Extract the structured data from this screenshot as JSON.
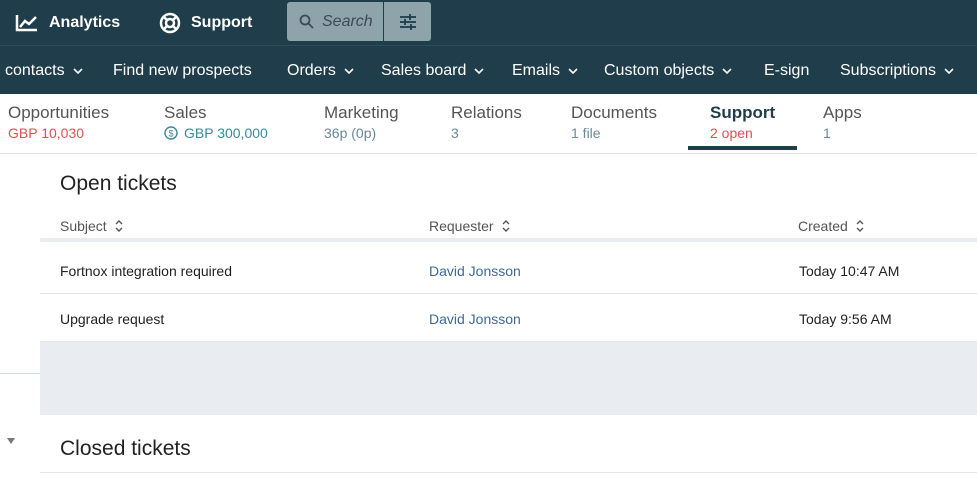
{
  "topbar": {
    "analytics_label": "Analytics",
    "analytics_icon": "chart-line-icon",
    "support_label": "Support",
    "support_icon": "lifebuoy-icon",
    "search_placeholder": "Search",
    "filter_icon": "sliders-icon",
    "background": "#1f3d4a"
  },
  "nav": {
    "items": [
      {
        "label": "contacts",
        "dropdown": true
      },
      {
        "label": "Find new prospects",
        "dropdown": false
      },
      {
        "label": "Orders",
        "dropdown": true
      },
      {
        "label": "Sales board",
        "dropdown": true
      },
      {
        "label": "Emails",
        "dropdown": true
      },
      {
        "label": "Custom objects",
        "dropdown": true
      },
      {
        "label": "E-sign",
        "dropdown": false
      },
      {
        "label": "Subscriptions",
        "dropdown": true
      }
    ]
  },
  "tabs": [
    {
      "title": "Opportunities",
      "sub": "GBP 10,030"
    },
    {
      "title": "Sales",
      "sub": "GBP 300,000"
    },
    {
      "title": "Marketing",
      "sub": "36p (0p)"
    },
    {
      "title": "Relations",
      "sub": "3"
    },
    {
      "title": "Documents",
      "sub": "1 file"
    },
    {
      "title": "Support",
      "sub": "2 open",
      "active": true
    },
    {
      "title": "Apps",
      "sub": "1"
    }
  ],
  "open_tickets": {
    "title": "Open tickets",
    "columns": [
      "Subject",
      "Requester",
      "Created"
    ],
    "rows": [
      {
        "subject": "Fortnox integration required",
        "requester": "David Jonsson",
        "created": "Today 10:47 AM"
      },
      {
        "subject": "Upgrade request",
        "requester": "David Jonsson",
        "created": "Today 9:56 AM"
      }
    ]
  },
  "closed_tickets": {
    "title": "Closed tickets"
  },
  "colors": {
    "accent": "#1f3d4a",
    "negative": "#d9534f",
    "link": "#3b6b9a"
  }
}
